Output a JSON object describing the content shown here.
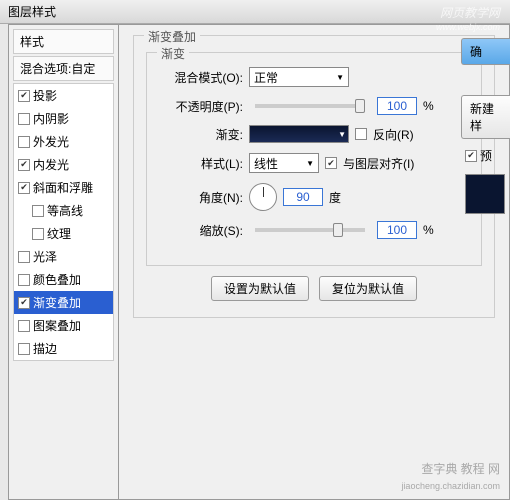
{
  "window": {
    "title": "图层样式"
  },
  "sidebar": {
    "header": "样式",
    "mix": "混合选项:自定",
    "items": [
      {
        "label": "投影",
        "checked": true,
        "indent": false
      },
      {
        "label": "内阴影",
        "checked": false,
        "indent": false
      },
      {
        "label": "外发光",
        "checked": false,
        "indent": false
      },
      {
        "label": "内发光",
        "checked": true,
        "indent": false
      },
      {
        "label": "斜面和浮雕",
        "checked": true,
        "indent": false
      },
      {
        "label": "等高线",
        "checked": false,
        "indent": true
      },
      {
        "label": "纹理",
        "checked": false,
        "indent": true
      },
      {
        "label": "光泽",
        "checked": false,
        "indent": false
      },
      {
        "label": "颜色叠加",
        "checked": false,
        "indent": false
      },
      {
        "label": "渐变叠加",
        "checked": true,
        "indent": false,
        "selected": true
      },
      {
        "label": "图案叠加",
        "checked": false,
        "indent": false
      },
      {
        "label": "描边",
        "checked": false,
        "indent": false
      }
    ]
  },
  "panel": {
    "outer_legend": "渐变叠加",
    "inner_legend": "渐变",
    "blend_label": "混合模式(O):",
    "blend_value": "正常",
    "opacity_label": "不透明度(P):",
    "opacity_value": "100",
    "opacity_unit": "%",
    "gradient_label": "渐变:",
    "reverse_label": "反向(R)",
    "reverse_checked": false,
    "style_label": "样式(L):",
    "style_value": "线性",
    "align_label": "与图层对齐(I)",
    "align_checked": true,
    "angle_label": "角度(N):",
    "angle_value": "90",
    "angle_unit": "度",
    "scale_label": "缩放(S):",
    "scale_value": "100",
    "scale_unit": "%",
    "btn_default": "设置为默认值",
    "btn_reset": "复位为默认值"
  },
  "right": {
    "ok": "确",
    "new": "新建样",
    "preview_label": "预"
  },
  "watermark": {
    "top1": "网页教学网",
    "top2": "www.webjx.com",
    "bottom1": "查字典  教程 网",
    "bottom2": "jiaocheng.chazidian.com"
  }
}
